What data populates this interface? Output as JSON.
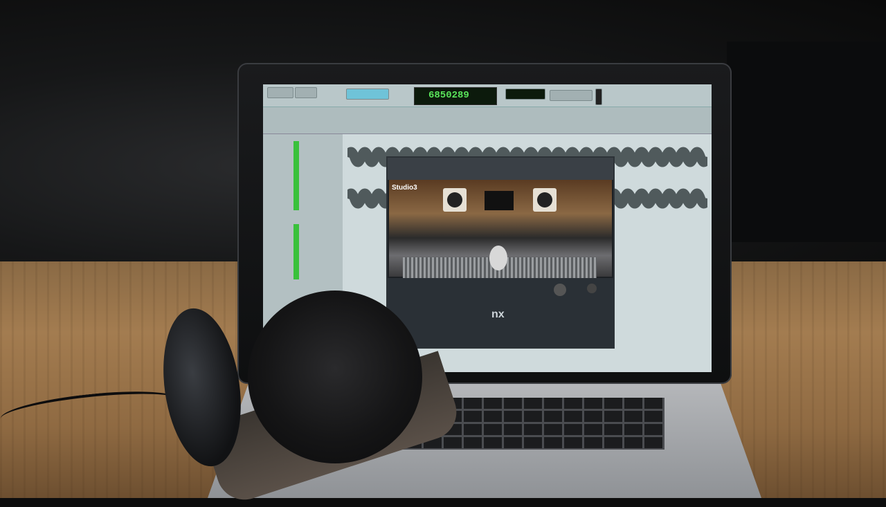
{
  "scene": {
    "description_elements": [
      "laptop",
      "headphones",
      "desk"
    ],
    "daw": {
      "counter_value": "6850289"
    },
    "plugin": {
      "brand_label": "Studio3",
      "logo_label": "nx"
    }
  }
}
